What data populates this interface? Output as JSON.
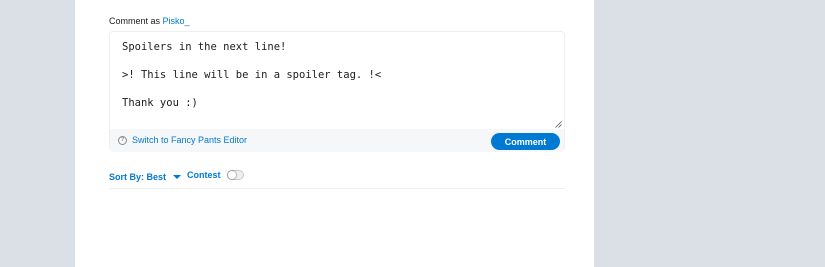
{
  "comment_box": {
    "prefix": "Comment as",
    "username": "Pisko_",
    "text": "Spoilers in the next line!\n\n>! This line will be in a spoiler tag. !<\n\nThank you :)",
    "switch_editor_label": "Switch to Fancy Pants Editor",
    "help_icon": "question-circle-icon",
    "submit_label": "Comment"
  },
  "sort": {
    "label": "Sort By: Best",
    "icon": "caret-down-icon"
  },
  "contest": {
    "label": "Contest",
    "enabled": false
  },
  "colors": {
    "background": "#dae0e6",
    "card": "#ffffff",
    "accent": "#0079d3",
    "footer": "#f6f7f8"
  }
}
